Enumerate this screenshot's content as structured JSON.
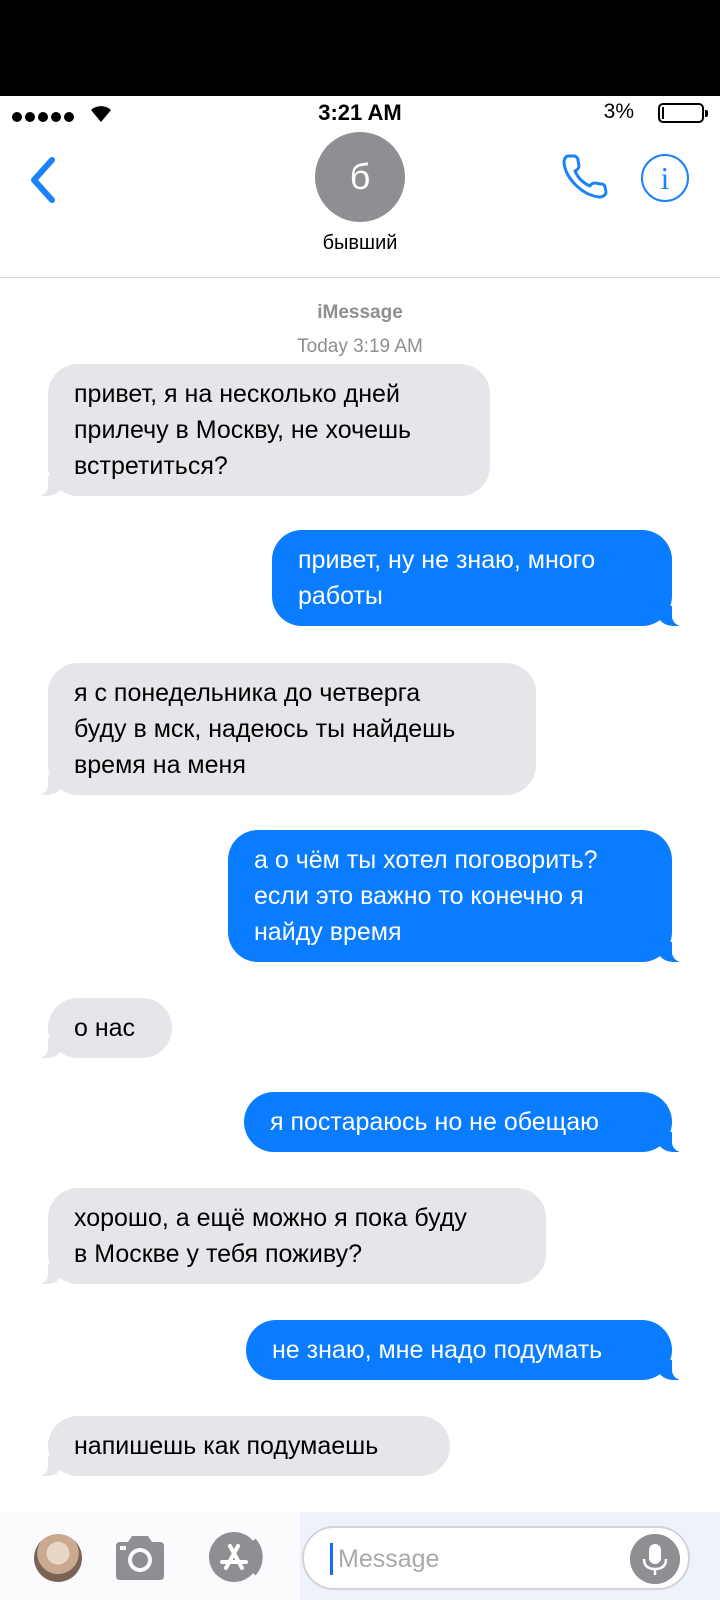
{
  "status_bar": {
    "time": "3:21 AM",
    "battery_percent": "3%",
    "battery_level": 0.03
  },
  "nav": {
    "contact_initial": "б",
    "contact_name": "бывший",
    "info_glyph": "i"
  },
  "conversation": {
    "service": "iMessage",
    "timestamp": "Today 3:19 AM",
    "messages": [
      {
        "from": "them",
        "text": "привет, я на несколько дней\nприлечу в Москву, не хочешь\nвстретиться?"
      },
      {
        "from": "me",
        "text": "привет, ну не знаю, много\nработы"
      },
      {
        "from": "them",
        "text": "я с понедельника до четверга\nбуду в мск, надеюсь ты найдешь\nвремя на меня"
      },
      {
        "from": "me",
        "text": "а о чём ты хотел поговорить?\nесли это важно то конечно я\nнайду время"
      },
      {
        "from": "them",
        "text": "о нас"
      },
      {
        "from": "me",
        "text": "я постараюсь но не обещаю"
      },
      {
        "from": "them",
        "text": "хорошо, а ещё можно я пока буду\nв Москве у тебя поживу?"
      },
      {
        "from": "me",
        "text": "не знаю, мне надо подумать"
      },
      {
        "from": "them",
        "text": "напишешь как подумаешь"
      }
    ]
  },
  "input_bar": {
    "placeholder": "Message",
    "value": ""
  },
  "colors": {
    "outgoing_bubble": "#0a7cff",
    "incoming_bubble": "#e5e5ea",
    "accent": "#1a82fb",
    "meta_text": "#8e8e93"
  },
  "icons": [
    "cellular-signal-icon",
    "wifi-icon",
    "battery-icon",
    "back-chevron-icon",
    "phone-icon",
    "info-icon",
    "camera-icon",
    "app-store-icon",
    "microphone-icon"
  ]
}
